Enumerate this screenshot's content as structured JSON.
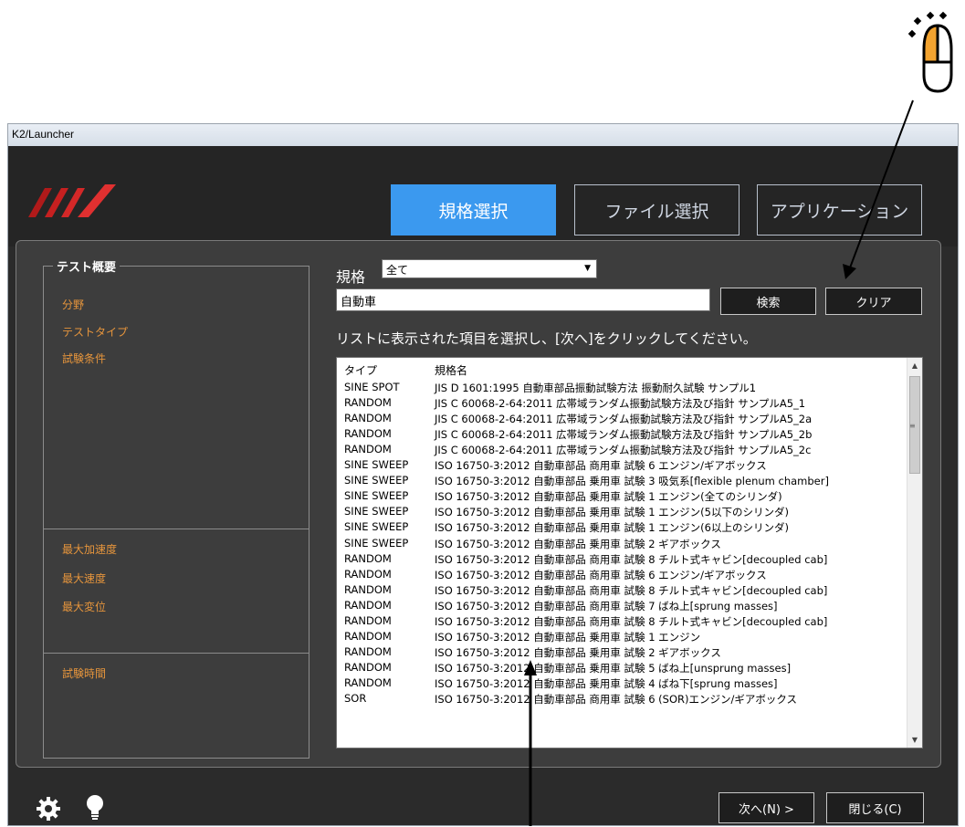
{
  "window": {
    "title": "K2/Launcher"
  },
  "tabs": [
    {
      "label": "規格選択"
    },
    {
      "label": "ファイル選択"
    },
    {
      "label": "アプリケーション"
    }
  ],
  "summary": {
    "title": "テスト概要",
    "top_items": [
      "分野",
      "テストタイプ",
      "試験条件"
    ],
    "mid_items": [
      "最大加速度",
      "最大速度",
      "最大変位"
    ],
    "bottom_items": [
      "試験時間"
    ]
  },
  "filter": {
    "label": "規格",
    "selected": "全て",
    "search_value": "自動車",
    "search_button": "検索",
    "clear_button": "クリア",
    "instruction": "リストに表示された項目を選択し、[次へ]をクリックしてください。"
  },
  "list": {
    "columns": [
      "タイプ",
      "規格名"
    ],
    "rows": [
      {
        "type": "SINE SPOT",
        "name": "JIS D 1601:1995 自動車部品振動試験方法 振動耐久試験 サンプル1"
      },
      {
        "type": "RANDOM",
        "name": "JIS C 60068-2-64:2011 広帯域ランダム振動試験方法及び指針 サンプルA5_1"
      },
      {
        "type": "RANDOM",
        "name": "JIS C 60068-2-64:2011 広帯域ランダム振動試験方法及び指針 サンプルA5_2a"
      },
      {
        "type": "RANDOM",
        "name": "JIS C 60068-2-64:2011 広帯域ランダム振動試験方法及び指針 サンプルA5_2b"
      },
      {
        "type": "RANDOM",
        "name": "JIS C 60068-2-64:2011 広帯域ランダム振動試験方法及び指針 サンプルA5_2c"
      },
      {
        "type": "SINE SWEEP",
        "name": "ISO 16750-3:2012 自動車部品 商用車 試験 6 エンジン/ギアボックス"
      },
      {
        "type": "SINE SWEEP",
        "name": "ISO 16750-3:2012 自動車部品 乗用車 試験 3 吸気系[flexible plenum chamber]"
      },
      {
        "type": "SINE SWEEP",
        "name": "ISO 16750-3:2012 自動車部品 乗用車 試験 1 エンジン(全てのシリンダ)"
      },
      {
        "type": "SINE SWEEP",
        "name": "ISO 16750-3:2012 自動車部品 乗用車 試験 1 エンジン(5以下のシリンダ)"
      },
      {
        "type": "SINE SWEEP",
        "name": "ISO 16750-3:2012 自動車部品 乗用車 試験 1 エンジン(6以上のシリンダ)"
      },
      {
        "type": "SINE SWEEP",
        "name": "ISO 16750-3:2012 自動車部品 乗用車 試験 2 ギアボックス"
      },
      {
        "type": "RANDOM",
        "name": "ISO 16750-3:2012 自動車部品 商用車 試験 8 チルト式キャビン[decoupled cab]"
      },
      {
        "type": "RANDOM",
        "name": "ISO 16750-3:2012 自動車部品 商用車 試験 6 エンジン/ギアボックス"
      },
      {
        "type": "RANDOM",
        "name": "ISO 16750-3:2012 自動車部品 商用車 試験 8 チルト式キャビン[decoupled cab]"
      },
      {
        "type": "RANDOM",
        "name": "ISO 16750-3:2012 自動車部品 商用車 試験 7 ばね上[sprung masses]"
      },
      {
        "type": "RANDOM",
        "name": "ISO 16750-3:2012 自動車部品 商用車 試験 8 チルト式キャビン[decoupled cab]"
      },
      {
        "type": "RANDOM",
        "name": "ISO 16750-3:2012 自動車部品 乗用車 試験 1 エンジン"
      },
      {
        "type": "RANDOM",
        "name": "ISO 16750-3:2012 自動車部品 乗用車 試験 2 ギアボックス"
      },
      {
        "type": "RANDOM",
        "name": "ISO 16750-3:2012 自動車部品 乗用車 試験 5 ばね上[unsprung masses]"
      },
      {
        "type": "RANDOM",
        "name": "ISO 16750-3:2012 自動車部品 乗用車 試験 4 ばね下[sprung masses]"
      },
      {
        "type": "SOR",
        "name": "ISO 16750-3:2012 自動車部品 商用車 試験 6 (SOR)エンジン/ギアボックス"
      }
    ]
  },
  "footer": {
    "next_button": "次へ(N) >",
    "close_button": "閉じる(C)"
  },
  "colors": {
    "accent": "#3b99ef",
    "label_orange": "#e6953c",
    "panel": "#3d3d3d",
    "background": "#252525"
  },
  "icons": [
    "logo-icon",
    "gear-icon",
    "lightbulb-icon",
    "mouse-icon",
    "dropdown-arrow-icon"
  ]
}
